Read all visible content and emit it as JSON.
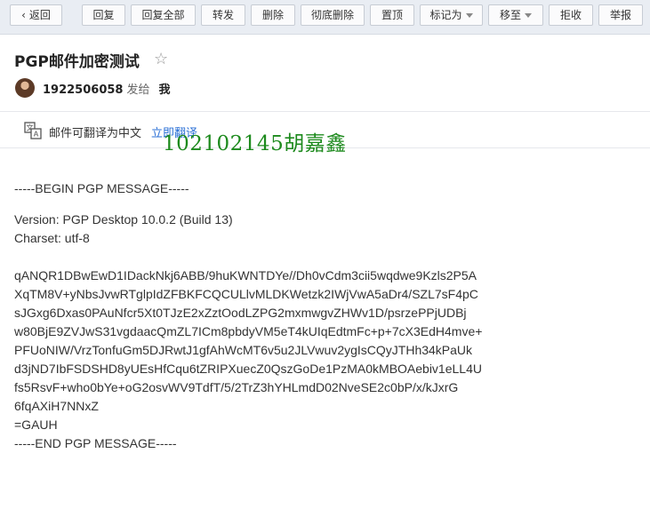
{
  "toolbar": {
    "back": "返回",
    "reply": "回复",
    "reply_all": "回复全部",
    "forward": "转发",
    "delete": "删除",
    "delete_permanently": "彻底删除",
    "pin": "置顶",
    "mark_as": "标记为",
    "move_to": "移至",
    "reject": "拒收",
    "report": "举报"
  },
  "mail": {
    "subject": "PGP邮件加密测试",
    "sender": "1922506058",
    "sent_to_label": "发给",
    "recipient": "我"
  },
  "translate": {
    "text": "邮件可翻译为中文",
    "link": "立即翻译"
  },
  "watermark": "102102145胡嘉鑫",
  "body_lines": {
    "l0": "-----BEGIN PGP MESSAGE-----",
    "l1": "Version: PGP Desktop 10.0.2 (Build 13)",
    "l2": "Charset: utf-8",
    "l3": "qANQR1DBwEwD1IDackNkj6ABB/9huKWNTDYe//Dh0vCdm3cii5wqdwe9Kzls2P5A",
    "l4": "XqTM8V+yNbsJvwRTglpIdZFBKFCQCULlvMLDKWetzk2IWjVwA5aDr4/SZL7sF4pC",
    "l5": "sJGxg6Dxas0PAuNfcr5Xt0TJzE2xZztOodLZPG2mxmwgvZHWv1D/psrzePPjUDBj",
    "l6": "w80BjE9ZVJwS31vgdaacQmZL7ICm8pbdyVM5eT4kUIqEdtmFc+p+7cX3EdH4mve+",
    "l7": "PFUoNIW/VrzTonfuGm5DJRwtJ1gfAhWcMT6v5u2JLVwuv2ygIsCQyJTHh34kPaUk",
    "l8": "d3jND7IbFSDSHD8yUEsHfCqu6tZRIPXuecZ0QszGoDe1PzMA0kMBOAebiv1eLL4U",
    "l9": "fs5RsvF+who0bYe+oG2osvWV9TdfT/5/2TrZ3hYHLmdD02NveSE2c0bP/x/kJxrG",
    "l10": "6fqAXiH7NNxZ",
    "l11": "=GAUH",
    "l12": "-----END PGP MESSAGE-----"
  },
  "colors": {
    "toolbar_bg": "#e9edf3",
    "link": "#2a6fd6",
    "watermark": "#1d8a1d"
  },
  "icons": {
    "back": "chevron-left-icon",
    "star": "star-outline-icon",
    "translate": "translate-icon",
    "dropdown": "caret-down-icon"
  }
}
